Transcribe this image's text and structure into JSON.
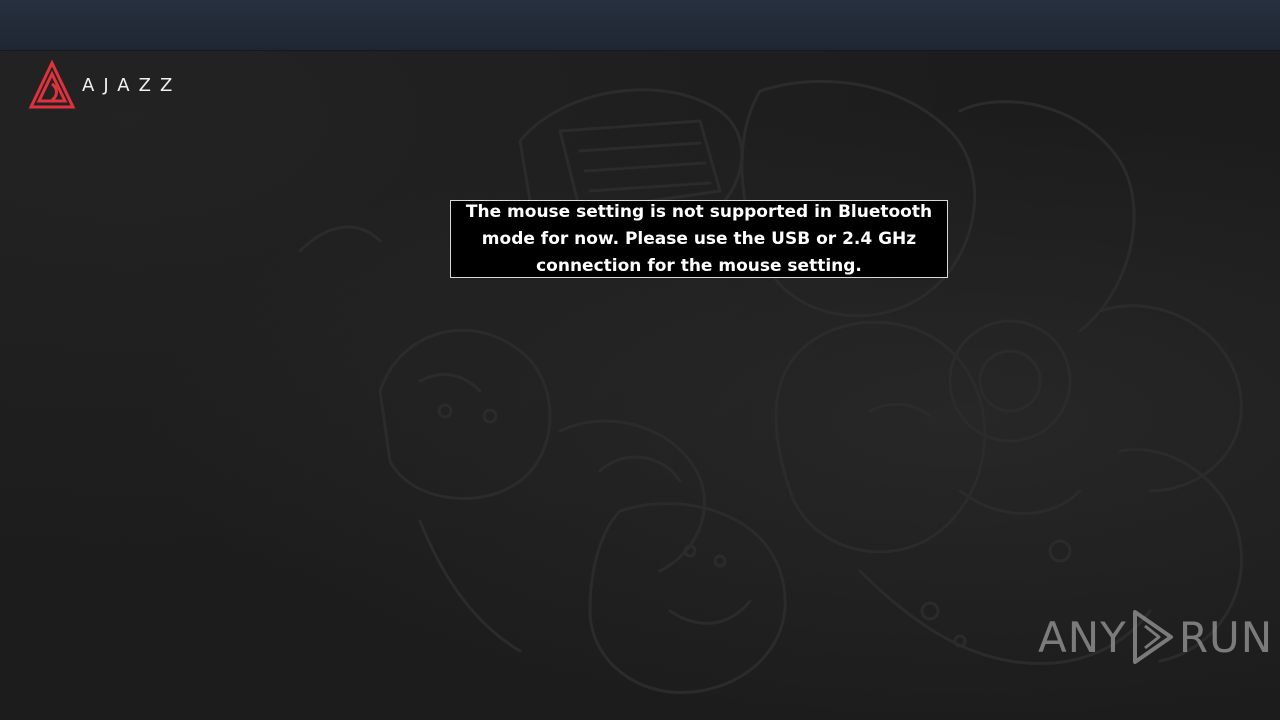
{
  "app": {
    "brand": "AJAZZ",
    "notice": "The mouse setting is not supported in Bluetooth mode for now. Please use the USB or 2.4 GHz connection for the mouse setting.",
    "accent_color": "#e0323c"
  },
  "watermark": {
    "left_text": "ANY",
    "right_text": "RUN",
    "icon": "play-icon"
  }
}
